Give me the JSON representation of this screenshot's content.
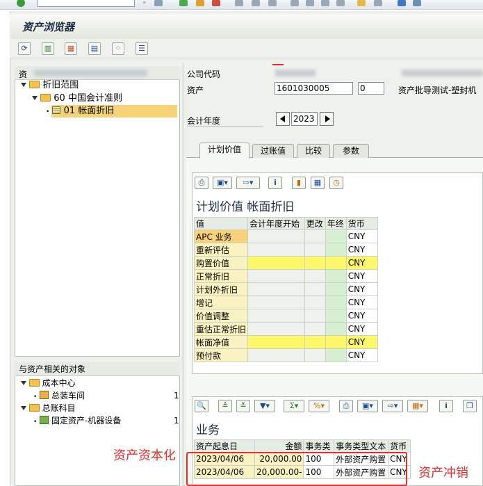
{
  "window": {
    "title": "资产浏览器"
  },
  "nav": {
    "header": "资",
    "items": [
      {
        "label": "折旧范围"
      },
      {
        "label": "60  中国会计准则"
      },
      {
        "label": "01  帐面折旧"
      }
    ]
  },
  "objects": {
    "header": "与资产相关的对象",
    "groups": [
      {
        "label": "成本中心",
        "child": "总装车间",
        "count": "1"
      },
      {
        "label": "总账科目",
        "child": "固定资产-机器设备",
        "count": "1"
      }
    ]
  },
  "form": {
    "company_label": "公司代码",
    "asset_label": "资产",
    "asset_value": "1601030005",
    "subnumber_value": "0",
    "asset_desc": "资产批导测试-塑封机",
    "fiscal_year_label": "会计年度",
    "fiscal_year_value": "2023"
  },
  "tabs": [
    {
      "label": "计划价值"
    },
    {
      "label": "过账值"
    },
    {
      "label": "比较"
    },
    {
      "label": "参数"
    }
  ],
  "planned": {
    "title": "计划价值 帐面折旧",
    "columns": [
      "值",
      "会计年度开始",
      "更改",
      "年终",
      "货币"
    ],
    "rows": [
      {
        "label": "APC 业务",
        "currency": "CNY"
      },
      {
        "label": "重新评估",
        "currency": "CNY"
      },
      {
        "label": "购置价值",
        "currency": "CNY"
      },
      {
        "label": "正常折旧",
        "currency": "CNY"
      },
      {
        "label": "计划外折旧",
        "currency": "CNY"
      },
      {
        "label": "增记",
        "currency": "CNY"
      },
      {
        "label": "价值调整",
        "currency": "CNY"
      },
      {
        "label": "重估正常折旧",
        "currency": "CNY"
      },
      {
        "label": "帐面净值",
        "currency": "CNY"
      },
      {
        "label": "预付款",
        "currency": "CNY"
      }
    ]
  },
  "transactions": {
    "title": "业务",
    "columns": [
      "资产起息日",
      "金额",
      "事务类",
      "事务类型文本",
      "货币"
    ],
    "rows": [
      {
        "date": "2023/04/06",
        "amount": "20,000.00",
        "type": "100",
        "text": "外部资产购置",
        "currency": "CNY"
      },
      {
        "date": "2023/04/06",
        "amount": "20,000.00-",
        "type": "100",
        "text": "外部资产购置",
        "currency": "CNY"
      }
    ]
  },
  "annotations": {
    "capitalization": "资产资本化",
    "reversal": "资产冲销"
  },
  "colors": {
    "highlight_box": "#e52f2f",
    "yellow_cell": "#fff76a",
    "green_cell": "#d7f0d1"
  }
}
